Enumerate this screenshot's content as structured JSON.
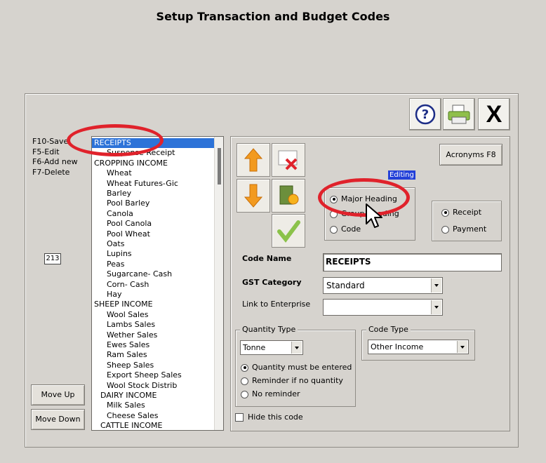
{
  "title": "Setup Transaction and Budget  Codes",
  "toolbar": {
    "help_icon": "question-icon",
    "print_icon": "printer-icon",
    "close_icon": "close-x-icon",
    "close_label": "X"
  },
  "shortcuts": [
    "F10-Save",
    "F5-Edit",
    "F6-Add new",
    "F7-Delete"
  ],
  "record_number": "213",
  "buttons": {
    "move_up": "Move Up",
    "move_down": "Move Down",
    "acronyms": "Acronyms F8"
  },
  "code_list": [
    {
      "text": "RECEIPTS",
      "indent": 0,
      "selected": true
    },
    {
      "text": "Suspense Receipt",
      "indent": 2
    },
    {
      "text": "CROPPING INCOME",
      "indent": 0
    },
    {
      "text": "Wheat",
      "indent": 2
    },
    {
      "text": "Wheat Futures-Gic",
      "indent": 2
    },
    {
      "text": "Barley",
      "indent": 2
    },
    {
      "text": "Pool Barley",
      "indent": 2
    },
    {
      "text": "Canola",
      "indent": 2
    },
    {
      "text": "Pool Canola",
      "indent": 2
    },
    {
      "text": "Pool Wheat",
      "indent": 2
    },
    {
      "text": "Oats",
      "indent": 2
    },
    {
      "text": "Lupins",
      "indent": 2
    },
    {
      "text": "Peas",
      "indent": 2
    },
    {
      "text": "Sugarcane- Cash",
      "indent": 2
    },
    {
      "text": "Corn- Cash",
      "indent": 2
    },
    {
      "text": "Hay",
      "indent": 2
    },
    {
      "text": "SHEEP INCOME",
      "indent": 0
    },
    {
      "text": "Wool Sales",
      "indent": 2
    },
    {
      "text": "Lambs Sales",
      "indent": 2
    },
    {
      "text": "Wether Sales",
      "indent": 2
    },
    {
      "text": "Ewes Sales",
      "indent": 2
    },
    {
      "text": "Ram Sales",
      "indent": 2
    },
    {
      "text": "Sheep Sales",
      "indent": 2
    },
    {
      "text": "Export Sheep Sales",
      "indent": 2
    },
    {
      "text": "Wool Stock Distrib",
      "indent": 2
    },
    {
      "text": "DAIRY INCOME",
      "indent": 1
    },
    {
      "text": "Milk Sales",
      "indent": 2
    },
    {
      "text": "Cheese Sales",
      "indent": 2
    },
    {
      "text": "CATTLE INCOME",
      "indent": 1
    }
  ],
  "editing_badge": "Editing",
  "heading_type": {
    "options": [
      "Major Heading",
      "Group Heading",
      "Code"
    ],
    "selected": "Major Heading"
  },
  "direction": {
    "options": [
      "Receipt",
      "Payment"
    ],
    "selected": "Receipt"
  },
  "form": {
    "code_name_label": "Code Name",
    "code_name_value": "RECEIPTS",
    "gst_label": "GST Category",
    "gst_value": "Standard",
    "enterprise_label": "Link to Enterprise",
    "enterprise_value": "",
    "quantity_type_label": "Quantity Type",
    "quantity_type_value": "Tonne",
    "quantity_options": [
      "Quantity must be entered",
      "Reminder if no quantity",
      "No reminder"
    ],
    "quantity_selected": "Quantity must be entered",
    "code_type_label": "Code Type",
    "code_type_value": "Other  Income",
    "hide_label": "Hide this code",
    "hide_checked": false
  },
  "colors": {
    "selection": "#2d73d8",
    "annotation": "#e0222b",
    "editing_badge": "#2340d8"
  }
}
